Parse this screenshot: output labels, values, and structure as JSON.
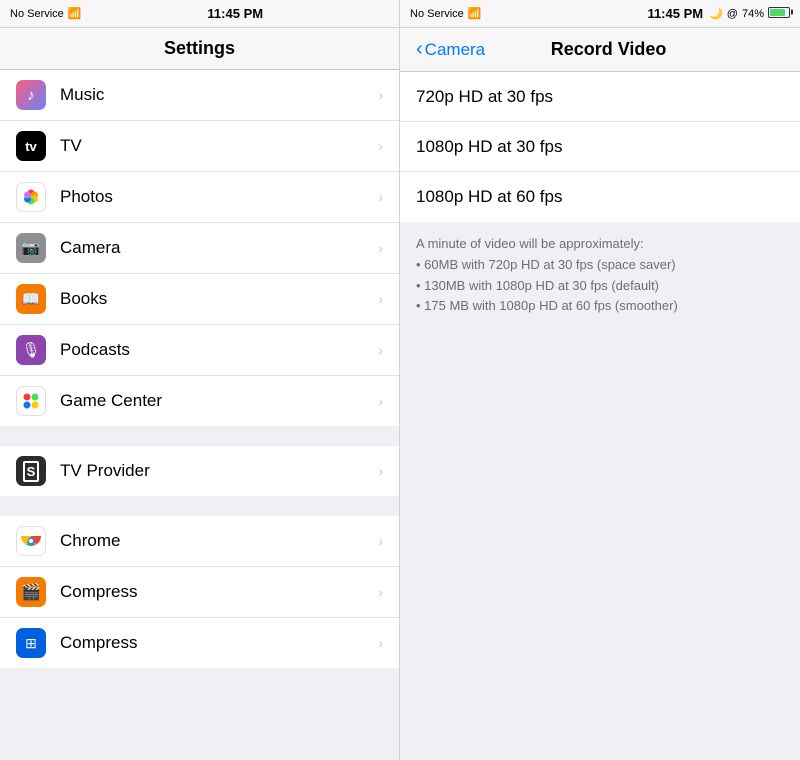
{
  "statusBar": {
    "left": {
      "signal": "No Service",
      "wifi": "⁓",
      "time": "11:45 PM"
    },
    "right": {
      "signal": "No Service",
      "wifi": "⁓",
      "time": "11:45 PM",
      "moon": "🌙",
      "at": "@",
      "battery": "74%"
    }
  },
  "leftPanel": {
    "title": "Settings",
    "sections": [
      {
        "id": "media",
        "items": [
          {
            "id": "music",
            "label": "Music",
            "icon": "music",
            "iconBg": "music"
          },
          {
            "id": "tv",
            "label": "TV",
            "icon": "tv",
            "iconBg": "tv"
          },
          {
            "id": "photos",
            "label": "Photos",
            "icon": "photos",
            "iconBg": "photos"
          },
          {
            "id": "camera",
            "label": "Camera",
            "icon": "camera",
            "iconBg": "camera"
          },
          {
            "id": "books",
            "label": "Books",
            "icon": "books",
            "iconBg": "books"
          },
          {
            "id": "podcasts",
            "label": "Podcasts",
            "icon": "podcasts",
            "iconBg": "podcasts"
          },
          {
            "id": "gamecenter",
            "label": "Game Center",
            "icon": "gamecenter",
            "iconBg": "gamecenter"
          }
        ]
      },
      {
        "id": "provider",
        "items": [
          {
            "id": "tvprovider",
            "label": "TV Provider",
            "icon": "tvprovider",
            "iconBg": "tvprovider"
          }
        ]
      },
      {
        "id": "apps",
        "items": [
          {
            "id": "chrome",
            "label": "Chrome",
            "icon": "chrome",
            "iconBg": "chrome"
          },
          {
            "id": "compress1",
            "label": "Compress",
            "icon": "compress-orange",
            "iconBg": "compress-orange"
          },
          {
            "id": "compress2",
            "label": "Compress",
            "icon": "compress-blue",
            "iconBg": "compress-blue"
          }
        ]
      }
    ]
  },
  "rightPanel": {
    "backLabel": "Camera",
    "title": "Record Video",
    "options": [
      {
        "id": "720p30",
        "label": "720p HD at 30 fps",
        "selected": false
      },
      {
        "id": "1080p30",
        "label": "1080p HD at 30 fps",
        "selected": false
      },
      {
        "id": "1080p60",
        "label": "1080p HD at 60 fps",
        "selected": true
      }
    ],
    "infoText": "A minute of video will be approximately:\n• 60MB with 720p HD at 30 fps (space saver)\n• 130MB with 1080p HD at 30 fps (default)\n• 175 MB with 1080p HD at 60 fps (smoother)"
  }
}
